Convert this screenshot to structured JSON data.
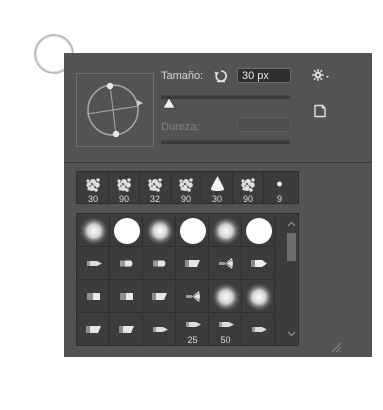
{
  "brush_panel": {
    "size_label": "Tamaño:",
    "size_value": "30 px",
    "size_fraction": 0.06,
    "hardness_label": "Dureza:",
    "gear_icon": "gear-with-dropdown-icon",
    "reset_icon": "reset-rotate-icon",
    "new_preset_icon": "new-preset-icon",
    "recent_brushes": [
      {
        "icon": "textured-brush-icon",
        "size": "30"
      },
      {
        "icon": "textured-brush-icon",
        "size": "90"
      },
      {
        "icon": "textured-brush-icon",
        "size": "32"
      },
      {
        "icon": "textured-brush-icon",
        "size": "90"
      },
      {
        "icon": "triangle-brush-icon",
        "size": "30"
      },
      {
        "icon": "textured-brush-icon",
        "size": "90"
      },
      {
        "icon": "dot-brush-icon",
        "size": "9"
      }
    ],
    "brush_grid": [
      {
        "icon": "soft-round-brush-icon",
        "size": ""
      },
      {
        "icon": "hard-round-brush-icon",
        "size": ""
      },
      {
        "icon": "soft-round-brush-icon",
        "size": ""
      },
      {
        "icon": "hard-round-brush-icon",
        "size": ""
      },
      {
        "icon": "soft-round-brush-icon",
        "size": ""
      },
      {
        "icon": "hard-round-brush-icon",
        "size": ""
      },
      {
        "icon": "pencil-tip-brush-icon",
        "size": ""
      },
      {
        "icon": "flat-tip-brush-icon",
        "size": ""
      },
      {
        "icon": "flat-tip-brush-icon",
        "size": ""
      },
      {
        "icon": "angled-tip-brush-icon",
        "size": ""
      },
      {
        "icon": "fan-tip-brush-icon",
        "size": ""
      },
      {
        "icon": "marker-tip-brush-icon",
        "size": ""
      },
      {
        "icon": "chisel-tip-brush-icon",
        "size": ""
      },
      {
        "icon": "chisel-tip-brush-icon",
        "size": ""
      },
      {
        "icon": "angled-tip-brush-icon",
        "size": ""
      },
      {
        "icon": "fan-tip-brush-icon",
        "size": ""
      },
      {
        "icon": "soft-round-brush-icon",
        "size": ""
      },
      {
        "icon": "soft-round-brush-icon",
        "size": ""
      },
      {
        "icon": "angled-tip-brush-icon",
        "size": ""
      },
      {
        "icon": "angled-tip-brush-icon",
        "size": ""
      },
      {
        "icon": "pencil-tip-brush-icon",
        "size": ""
      },
      {
        "icon": "pencil-tip-brush-icon",
        "size": "25"
      },
      {
        "icon": "pencil-tip-brush-icon",
        "size": "50"
      },
      {
        "icon": "pencil-tip-brush-icon",
        "size": ""
      }
    ]
  }
}
